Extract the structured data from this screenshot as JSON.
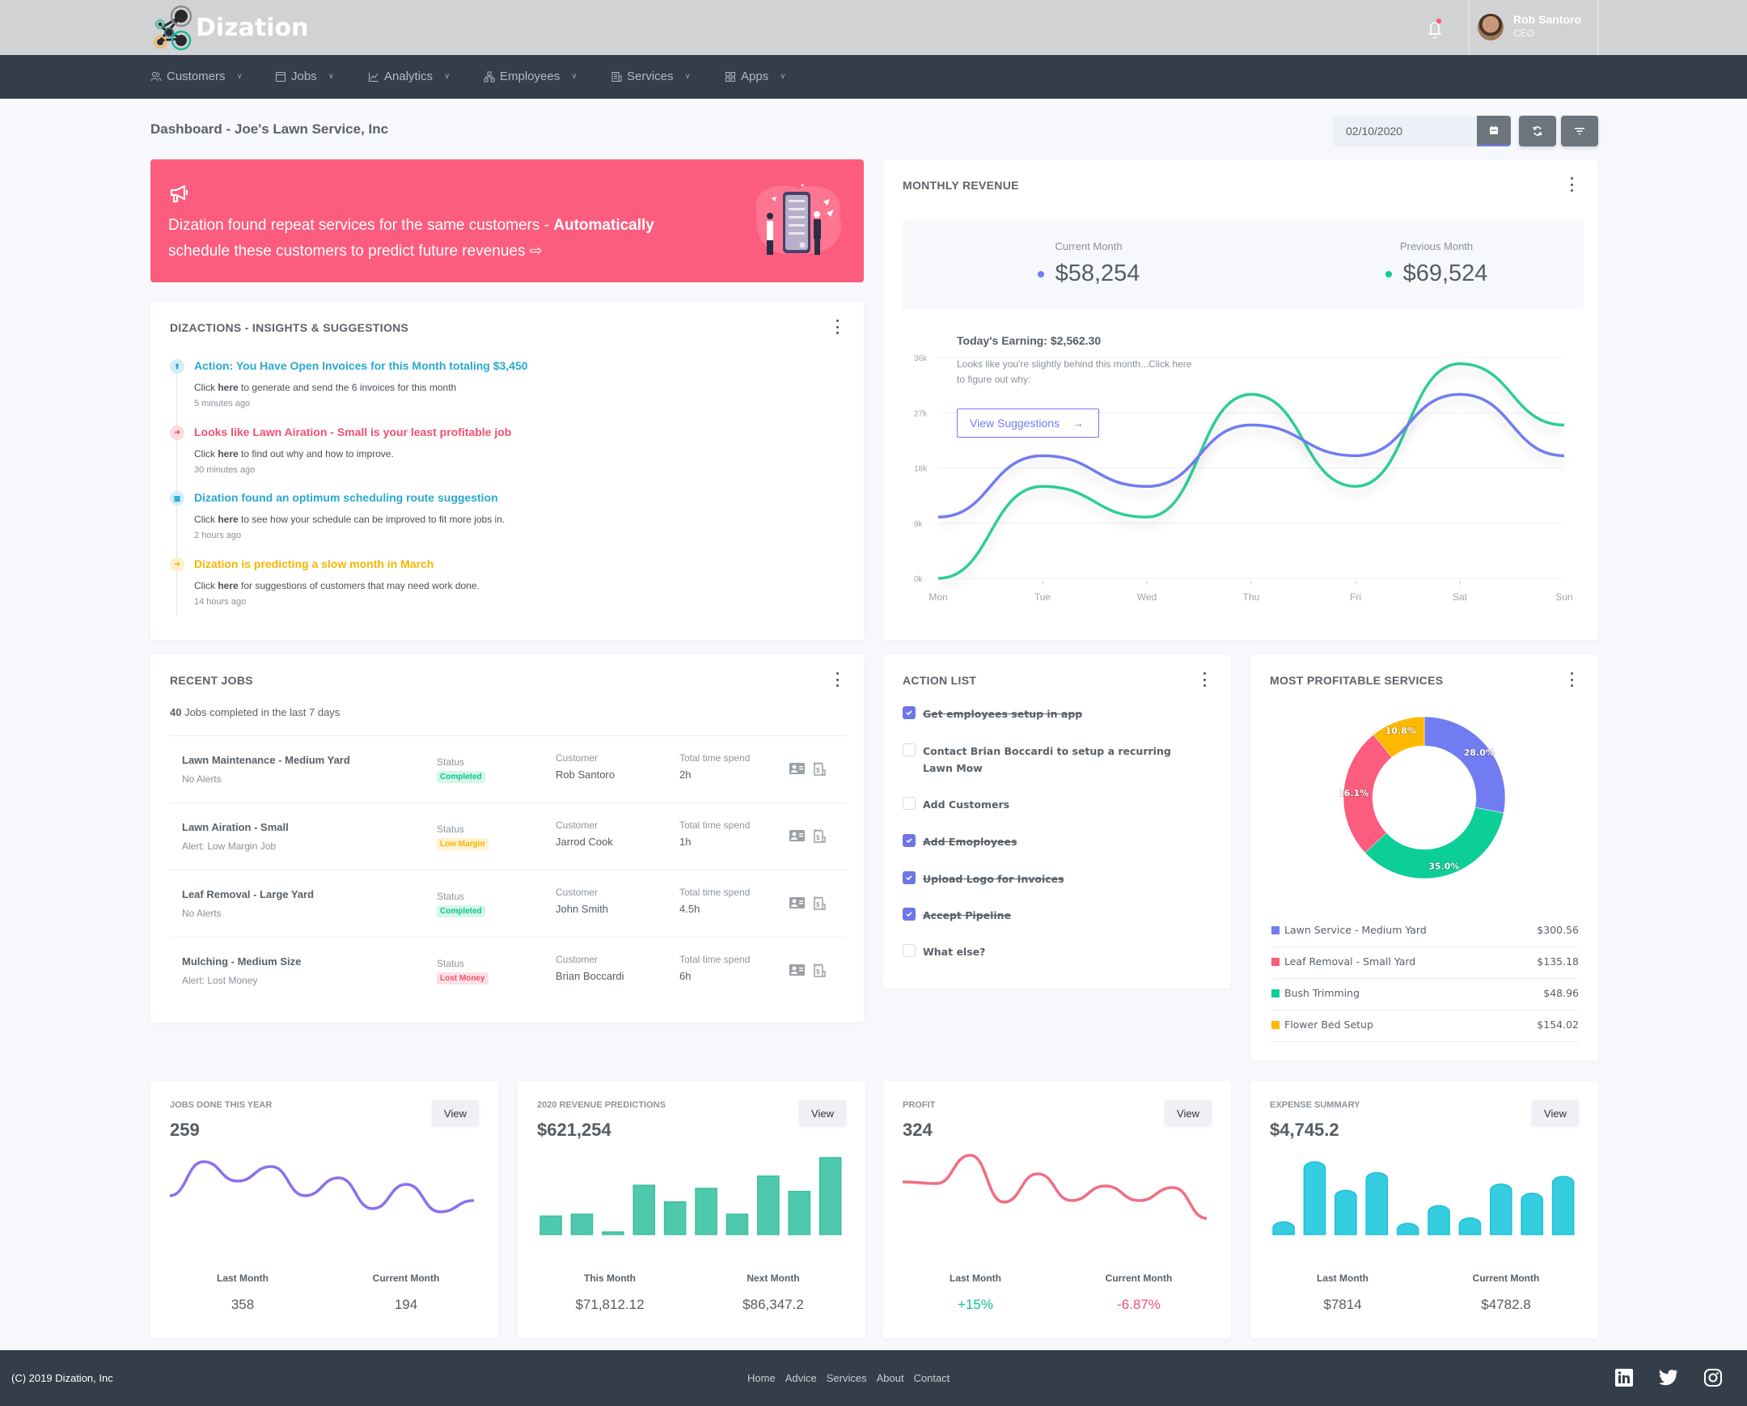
{
  "app": {
    "name": "Dization"
  },
  "header": {
    "user": {
      "name": "Rob Santoro",
      "role": "CEO"
    },
    "notifications": {
      "has_unread": true
    }
  },
  "nav": [
    {
      "label": "Customers",
      "icon": "users-icon"
    },
    {
      "label": "Jobs",
      "icon": "browser-icon"
    },
    {
      "label": "Analytics",
      "icon": "line-chart-icon"
    },
    {
      "label": "Employees",
      "icon": "hierarchy-icon"
    },
    {
      "label": "Services",
      "icon": "building-icon"
    },
    {
      "label": "Apps",
      "icon": "grid-icon"
    }
  ],
  "page": {
    "title": "Dashboard - Joe's Lawn Service, Inc",
    "date_value": "02/10/2020"
  },
  "banner": {
    "text_plain": "Dization found repeat services for the same customers - ",
    "text_bold": "Automatically",
    "text_rest": " schedule these customers to predict future revenues",
    "arrow": "⇨"
  },
  "insights": {
    "title": "DIZACTIONS - INSIGHTS & SUGGESTIONS",
    "items": [
      {
        "title": "Action: You Have Open Invoices for this Month totaling $3,450",
        "pre": "Click ",
        "link": "here",
        "post": " to generate and send the 6 invoices for this month",
        "time": "5 minutes ago",
        "color": "#2aa8d0",
        "bg": "#d3eef7",
        "icon": "⬆"
      },
      {
        "title": "Looks like Lawn Airation - Small is your least profitable job",
        "pre": "Click ",
        "link": "here",
        "post": " to find out why and how to improve.",
        "time": "30 minutes ago",
        "color": "#f0506e",
        "bg": "#fcdbe1",
        "icon": "➜"
      },
      {
        "title": "Dization found an optimum scheduling route suggestion",
        "pre": "Click ",
        "link": "here",
        "post": " to see how your schedule can be improved to fit more jobs in.",
        "time": "2 hours ago",
        "color": "#2aa8d0",
        "bg": "#d3eef7",
        "icon": "▦"
      },
      {
        "title": "Dization is predicting a slow month in March",
        "pre": "Click ",
        "link": "here",
        "post": " for suggestions of customers that may need work done.",
        "time": "14 hours ago",
        "color": "#f7b500",
        "bg": "#fdf0cf",
        "icon": "➜"
      }
    ]
  },
  "monthly_revenue": {
    "title": "MONTHLY REVENUE",
    "current_label": "Current Month",
    "current_value": "$58,254",
    "previous_label": "Previous Month",
    "previous_value": "$69,524",
    "todays_earning": "Today's Earning: $2,562.30",
    "note": "Looks like you're slightly behind this month...Click here to figure out why:",
    "button_label": "View Suggestions",
    "button_arrow": "→"
  },
  "recent_jobs": {
    "title": "RECENT JOBS",
    "summary_count": "40",
    "summary_text": " Jobs completed in the last 7 days",
    "status_label": "Status",
    "customer_label": "Customer",
    "time_label": "Total time spend",
    "rows": [
      {
        "name": "Lawn Maintenance - Medium Yard",
        "alert": "No Alerts",
        "status": "Completed",
        "status_color": "#0cc48f",
        "status_bg": "#d6f6ea",
        "customer": "Rob Santoro",
        "time": "2h"
      },
      {
        "name": "Lawn Airation - Small",
        "alert": "Alert: Low Margin Job",
        "status": "Low Margin",
        "status_color": "#f7b500",
        "status_bg": "#fff2d2",
        "customer": "Jarrod Cook",
        "time": "1h"
      },
      {
        "name": "Leaf Removal - Large Yard",
        "alert": "No Alerts",
        "status": "Completed",
        "status_color": "#0cc48f",
        "status_bg": "#d6f6ea",
        "customer": "John Smith",
        "time": "4.5h"
      },
      {
        "name": "Mulching - Medium Size",
        "alert": "Alert: Lost Money",
        "status": "Lost Money",
        "status_color": "#f0506e",
        "status_bg": "#fde0e6",
        "customer": "Brian Boccardi",
        "time": "6h"
      }
    ]
  },
  "action_list": {
    "title": "ACTION LIST",
    "items": [
      {
        "label": "Get employees setup in app",
        "done": true
      },
      {
        "label": "Contact Brian Boccardi to setup a recurring Lawn Mow",
        "done": false
      },
      {
        "label": "Add Customers",
        "done": false
      },
      {
        "label": "Add Emoployees",
        "done": true
      },
      {
        "label": "Upload Logo for Invoices",
        "done": true
      },
      {
        "label": "Accept Pipeline",
        "done": true
      },
      {
        "label": "What else?",
        "done": false
      }
    ]
  },
  "profitable_services": {
    "title": "MOST PROFITABLE SERVICES",
    "legend": [
      {
        "name": "Lawn Service - Medium Yard",
        "amount": "$300.56",
        "color": "#717cf2"
      },
      {
        "name": "Leaf Removal - Small Yard",
        "amount": "$135.18",
        "color": "#fc5c7d"
      },
      {
        "name": "Bush Trimming",
        "amount": "$48.96",
        "color": "#0ccf97"
      },
      {
        "name": "Flower Bed Setup",
        "amount": "$154.02",
        "color": "#ffb800"
      }
    ]
  },
  "stat_cards": [
    {
      "title": "JOBS DONE THIS YEAR",
      "value": "259",
      "button": "View",
      "left_label": "Last Month",
      "left_value": "358",
      "right_label": "Current Month",
      "right_value": "194",
      "left_color": "#555c63",
      "right_color": "#555c63"
    },
    {
      "title": "2020 REVENUE PREDICTIONS",
      "value": "$621,254",
      "button": "View",
      "left_label": "This Month",
      "left_value": "$71,812.12",
      "right_label": "Next Month",
      "right_value": "$86,347.2",
      "left_color": "#555c63",
      "right_color": "#555c63"
    },
    {
      "title": "PROFIT",
      "value": "324",
      "button": "View",
      "left_label": "Last Month",
      "left_value": "+15%",
      "right_label": "Current Month",
      "right_value": "-6.87%",
      "left_color": "#0cc48f",
      "right_color": "#f0506e"
    },
    {
      "title": "EXPENSE SUMMARY",
      "value": "$4,745.2",
      "button": "View",
      "left_label": "Last Month",
      "left_value": "$7814",
      "right_label": "Current Month",
      "right_value": "$4782.8",
      "left_color": "#555c63",
      "right_color": "#555c63"
    }
  ],
  "footer": {
    "copyright": "(C) 2019 Dization, Inc",
    "links": [
      "Home",
      "Advice",
      "Services",
      "About",
      "Contact"
    ]
  },
  "colors": {
    "accent": "#717cf2",
    "green": "#0ccf97",
    "pink": "#fc5c7d",
    "amber": "#ffb800",
    "nav_bg": "#343d4a"
  },
  "chart_data": [
    {
      "id": "monthly-revenue",
      "type": "line",
      "title": "Monthly Revenue",
      "categories": [
        "Mon",
        "Tue",
        "Wed",
        "Thu",
        "Fri",
        "Sat",
        "Sun"
      ],
      "ylim": [
        0,
        36000
      ],
      "yticks": [
        "0k",
        "9k",
        "18k",
        "27k",
        "36k"
      ],
      "grid": true,
      "series": [
        {
          "name": "Current Month",
          "color": "#717cf2",
          "values": [
            10000,
            20000,
            15000,
            25000,
            20000,
            30000,
            20000
          ]
        },
        {
          "name": "Previous Month",
          "color": "#2ecc9a",
          "values": [
            0,
            15000,
            10000,
            30000,
            15000,
            35000,
            25000
          ]
        }
      ]
    },
    {
      "id": "profitable-services",
      "type": "pie",
      "title": "Most Profitable Services",
      "labels": [
        "Lawn Service - Medium Yard",
        "Bush Trimming",
        "Leaf Removal - Small Yard",
        "Flower Bed Setup"
      ],
      "values": [
        28.0,
        35.0,
        26.1,
        10.8
      ],
      "colors": [
        "#717cf2",
        "#0ccf97",
        "#fc5c7d",
        "#ffb800"
      ]
    },
    {
      "id": "jobs-done-spark",
      "type": "line",
      "values": [
        4.8,
        9.0,
        6.6,
        8.4,
        4.8,
        7.0,
        3.2,
        6.2,
        2.8,
        4.2
      ],
      "color": "#8c6ff0"
    },
    {
      "id": "revenue-predictions-bars",
      "type": "bar",
      "values": [
        3.0,
        3.3,
        0.4,
        8.0,
        5.3,
        7.5,
        3.3,
        9.5,
        7.0,
        12.5
      ],
      "color": "#4fc9ad"
    },
    {
      "id": "profit-spark",
      "type": "line",
      "values": [
        6.5,
        6.3,
        9.8,
        4.0,
        7.5,
        4.2,
        6.0,
        4.2,
        5.8,
        2.0
      ],
      "color": "#f26d83"
    },
    {
      "id": "expense-bars",
      "type": "bar",
      "values": [
        2.2,
        10.0,
        6.3,
        8.6,
        2.0,
        4.3,
        2.7,
        7.1,
        5.9,
        8.1
      ],
      "color": "#35cde0"
    }
  ]
}
